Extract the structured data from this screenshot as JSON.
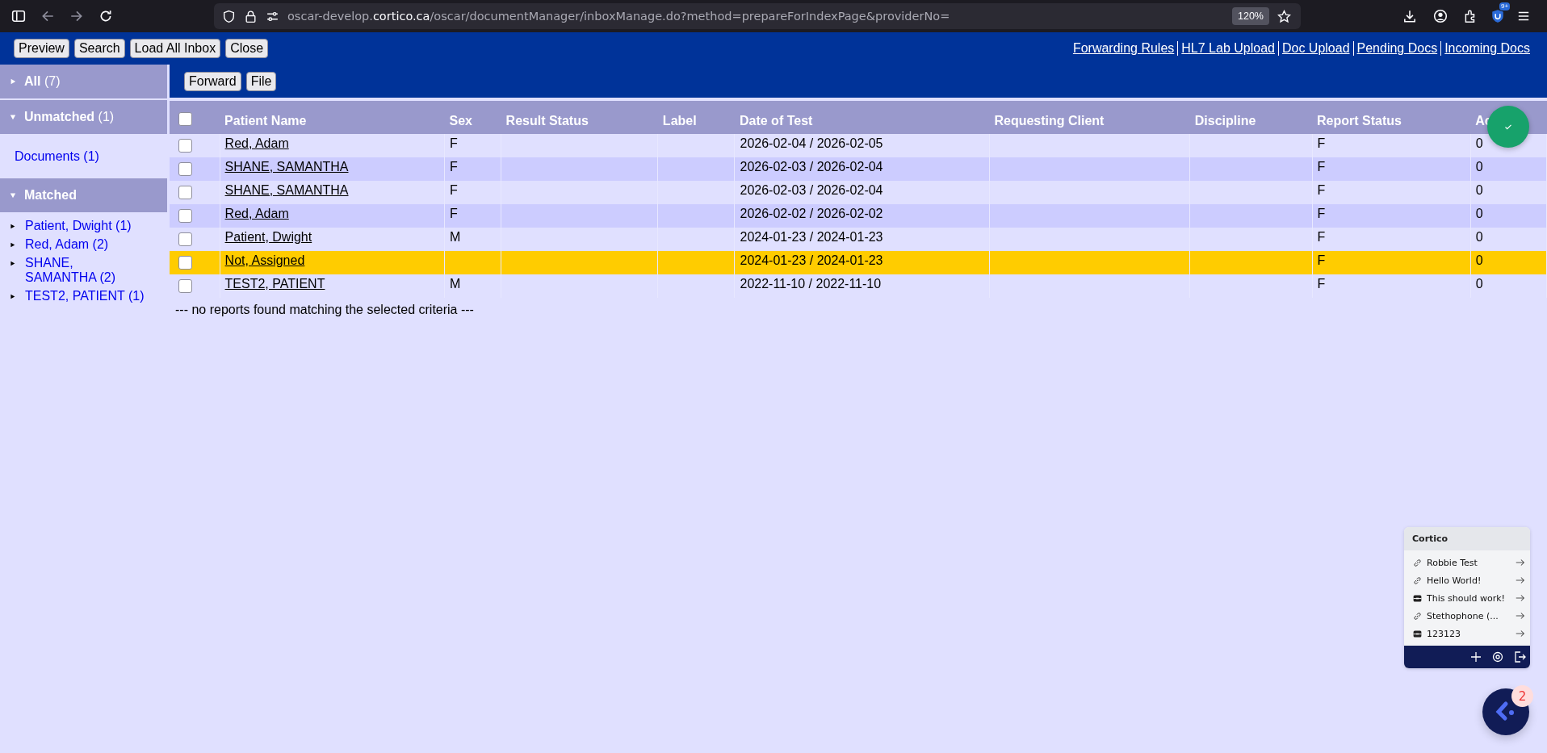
{
  "browser": {
    "url_host_prefix": "oscar-develop.",
    "url_host": "cortico.ca",
    "url_path": "/oscar/documentManager/inboxManage.do?method=prepareForIndexPage&providerNo=",
    "zoom": "120%",
    "badge": "9+"
  },
  "toolbar": {
    "buttons": [
      "Preview",
      "Search",
      "Load All Inbox",
      "Close"
    ],
    "links": [
      "Forwarding Rules",
      "HL7 Lab Upload",
      "Doc Upload",
      "Pending Docs",
      "Incoming Docs"
    ]
  },
  "sidebar": {
    "sections": [
      {
        "label": "All",
        "count": "(7)",
        "expanded": false
      },
      {
        "label": "Unmatched",
        "count": "(1)",
        "expanded": true,
        "items": [
          {
            "label": "Documents (1)",
            "kind": "plain"
          }
        ]
      },
      {
        "label": "Matched",
        "expanded": true,
        "items": [
          {
            "label": "Patient, Dwight (1)",
            "kind": "arrow"
          },
          {
            "label": "Red, Adam (2)",
            "kind": "arrow"
          },
          {
            "label": "SHANE, SAMANTHA (2)",
            "kind": "arrow"
          },
          {
            "label": "TEST2, PATIENT (1)",
            "kind": "arrow"
          }
        ]
      }
    ]
  },
  "actions": [
    "Forward",
    "File"
  ],
  "table": {
    "select_all_checked": false,
    "columns": [
      "Patient Name",
      "Sex",
      "Result Status",
      "Label",
      "Date of Test",
      "Requesting Client",
      "Discipline",
      "Report Status",
      "Ac"
    ],
    "rows": [
      {
        "checked": false,
        "highlighted": false,
        "cells": [
          "Red, Adam",
          "F",
          "",
          "",
          "2026-02-04 / 2026-02-05",
          "",
          "",
          "F",
          "0"
        ]
      },
      {
        "checked": false,
        "highlighted": false,
        "cells": [
          "SHANE, SAMANTHA",
          "F",
          "",
          "",
          "2026-02-03 / 2026-02-04",
          "",
          "",
          "F",
          "0"
        ]
      },
      {
        "checked": false,
        "highlighted": false,
        "cells": [
          "SHANE, SAMANTHA",
          "F",
          "",
          "",
          "2026-02-03 / 2026-02-04",
          "",
          "",
          "F",
          "0"
        ]
      },
      {
        "checked": false,
        "highlighted": false,
        "cells": [
          "Red, Adam",
          "F",
          "",
          "",
          "2026-02-02 / 2026-02-02",
          "",
          "",
          "F",
          "0"
        ]
      },
      {
        "checked": false,
        "highlighted": false,
        "cells": [
          "Patient, Dwight",
          "M",
          "",
          "",
          "2024-01-23 / 2024-01-23",
          "",
          "",
          "F",
          "0"
        ]
      },
      {
        "checked": false,
        "highlighted": true,
        "cells": [
          "Not, Assigned",
          "",
          "",
          "",
          "2024-01-23 / 2024-01-23",
          "",
          "",
          "F",
          "0"
        ]
      },
      {
        "checked": false,
        "highlighted": false,
        "cells": [
          "TEST2, PATIENT",
          "M",
          "",
          "",
          "2022-11-10 / 2022-11-10",
          "",
          "",
          "F",
          "0"
        ]
      }
    ],
    "footer": "--- no reports found matching the selected criteria ---"
  },
  "widget": {
    "title": "Cortico",
    "items": [
      {
        "label": "Robbie Test",
        "kind": "link"
      },
      {
        "label": "Hello World!",
        "kind": "link"
      },
      {
        "label": "This should work!",
        "kind": "box"
      },
      {
        "label": "Stethophone (...",
        "kind": "link"
      },
      {
        "label": "123123",
        "kind": "box"
      }
    ],
    "badge": "2"
  }
}
